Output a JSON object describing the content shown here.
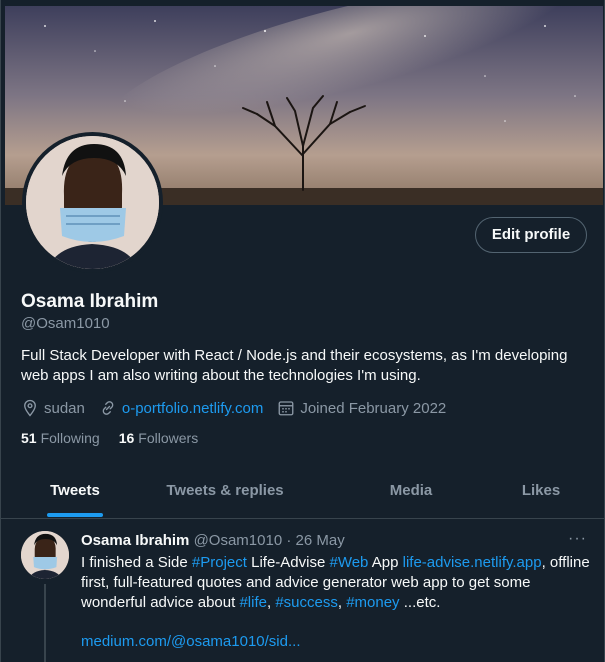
{
  "profile": {
    "name": "Osama Ibrahim",
    "handle": "@Osam1010",
    "edit_button": "Edit profile",
    "bio": "Full Stack Developer with React / Node.js and their ecosystems, as I'm developing web apps I am also writing about the technologies I'm using.",
    "location": "sudan",
    "website": "o-portfolio.netlify.com",
    "joined": "Joined February 2022",
    "following_count": "51",
    "following_label": "Following",
    "followers_count": "16",
    "followers_label": "Followers"
  },
  "tabs": [
    {
      "label": "Tweets",
      "active": true
    },
    {
      "label": "Tweets & replies",
      "active": false
    },
    {
      "label": "Media",
      "active": false
    },
    {
      "label": "Likes",
      "active": false
    }
  ],
  "tweet": {
    "author_name": "Osama Ibrahim",
    "author_handle": "@Osam1010",
    "separator": " · ",
    "date": "26 May",
    "more": "···",
    "t1": "I finished a Side ",
    "h1": "#Project",
    "t2": " Life-Advise ",
    "h2": "#Web",
    "t3": " App ",
    "l1": "life-advise.netlify.app",
    "t4": ", offline first, full-featured quotes and advice generator web app to get some wonderful advice about ",
    "h3": "#life",
    "t5": ", ",
    "h4": "#success",
    "t6": ", ",
    "h5": "#money",
    "t7": " ...etc.",
    "link": "medium.com/@osama1010/sid..."
  },
  "colors": {
    "background": "#15202b",
    "accent": "#1d9bf0",
    "text_primary": "#f7f9f9",
    "text_secondary": "#8b98a5",
    "border": "#38444d"
  },
  "icons": {
    "location": "location-pin-icon",
    "website": "link-icon",
    "joined": "calendar-icon",
    "more": "more-dots-icon"
  }
}
